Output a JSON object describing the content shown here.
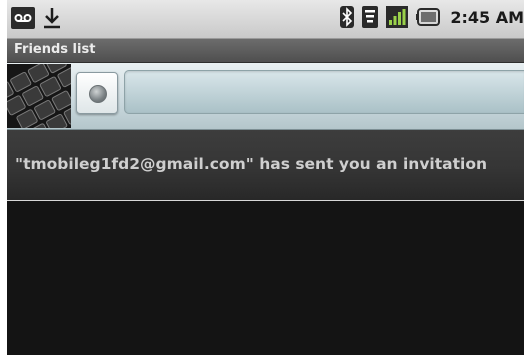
{
  "status_bar": {
    "time": "2:45 AM",
    "left_icons": [
      "voicemail-icon",
      "download-icon"
    ],
    "right_icons": [
      "bluetooth-icon",
      "wifi-icon",
      "signal-icon",
      "battery-icon"
    ]
  },
  "titlebar": {
    "title": "Friends list"
  },
  "profile": {
    "avatar_icon": "keyboard-photo",
    "presence_icon": "presence-status-icon",
    "status_message": ""
  },
  "invitation": {
    "text": "\"tmobileg1fd2@gmail.com\" has sent you an invitation"
  },
  "colors": {
    "title_bar": "#5d5d5d",
    "profile_bg": "#c9d8dd",
    "list_bg": "#141414",
    "invite_text": "#cfcfcf"
  }
}
